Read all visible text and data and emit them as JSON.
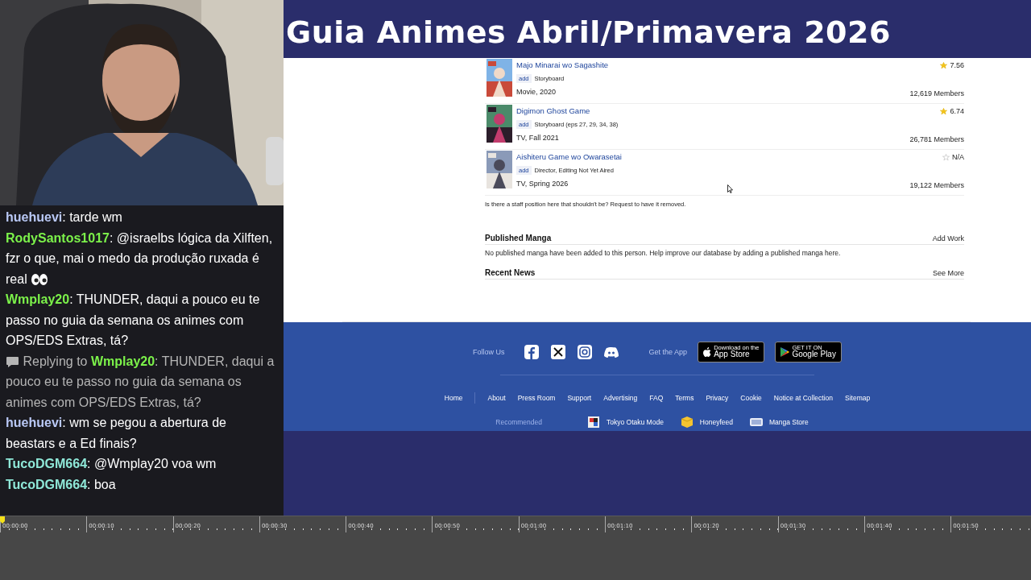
{
  "overlay_title": "Guia Animes Abril/Primavera 2026",
  "chat": [
    {
      "kind": "message",
      "user": "huehuevi",
      "separator": ":",
      "color": "#b9c8f5",
      "text": "tarde wm"
    },
    {
      "kind": "message",
      "user": "RodySantos1017",
      "separator": ":",
      "color": "#7cf24a",
      "text": "@israelbs lógica da Xilften, fzr o que, mai o medo da produção ruxada é real"
    },
    {
      "kind": "message",
      "user": "Wmplay20",
      "separator": ":",
      "color": "#7cf24a",
      "text": "THUNDER, daqui a pouco eu te passo no guia da semana os animes com OPS/EDS Extras, tá?"
    },
    {
      "kind": "reply",
      "lead": "Replying to",
      "user": "Wmplay20",
      "separator": ":",
      "color": "#7cf24a",
      "text": "THUNDER, daqui a pouco eu te passo no guia da semana os animes com OPS/EDS Extras, tá?"
    },
    {
      "kind": "message",
      "user": "huehuevi",
      "separator": ":",
      "color": "#b9c8f5",
      "text": "wm se pegou a abertura de beastars e a Ed finais?"
    },
    {
      "kind": "message",
      "user": "TucoDGM664",
      "separator": ":",
      "color": "#8fe8d8",
      "text": "@Wmplay20 voa wm"
    },
    {
      "kind": "message",
      "user": "TucoDGM664",
      "separator": ":",
      "color": "#8fe8d8",
      "text": "boa"
    }
  ],
  "works": [
    {
      "title": "Majo Minarai wo Sagashite",
      "tag": "add",
      "role": "Storyboard",
      "type": "Movie, 2020",
      "score": "7.56",
      "starred": true,
      "members": "12,619 Members"
    },
    {
      "title": "Digimon Ghost Game",
      "tag": "add",
      "role": "Storyboard (eps 27, 29, 34, 38)",
      "type": "TV, Fall 2021",
      "score": "6.74",
      "starred": true,
      "members": "26,781 Members"
    },
    {
      "title": "Aishiteru Game wo Owarasetai",
      "tag": "add",
      "role": "Director, Editing Not Yet Aired",
      "type": "TV, Spring 2026",
      "score": "N/A",
      "starred": false,
      "members": "19,122 Members"
    }
  ],
  "staff_note": {
    "text": "Is there a staff position here that shouldn't be?",
    "link": "Request to have it removed."
  },
  "sections": [
    {
      "title": "Published Manga",
      "action": "Add Work",
      "body": "No published manga have been added to this person. Help improve our database by adding a published manga here."
    },
    {
      "title": "Recent News",
      "action": "See More"
    }
  ],
  "footer": {
    "follow_label": "Follow Us",
    "app_label": "Get the App",
    "app_store": {
      "small": "Download on the",
      "big": "App Store"
    },
    "google_play": {
      "small": "GET IT ON",
      "big": "Google Play"
    },
    "links": [
      "Home",
      "About",
      "Press Room",
      "Support",
      "Advertising",
      "FAQ",
      "Terms",
      "Privacy",
      "Cookie",
      "Notice at Collection",
      "Sitemap"
    ],
    "recommended_label": "Recommended",
    "recommended": [
      "Tokyo Otaku Mode",
      "Honeyfeed",
      "Manga Store"
    ]
  },
  "timeline": {
    "ticks": [
      "00:00:00",
      "00:00:10",
      "00:00:20",
      "00:00:30",
      "00:00:40",
      "00:00:50",
      "00:01:00",
      "00:01:10",
      "00:01:20",
      "00:01:30",
      "00:01:40",
      "00:01:50"
    ]
  }
}
